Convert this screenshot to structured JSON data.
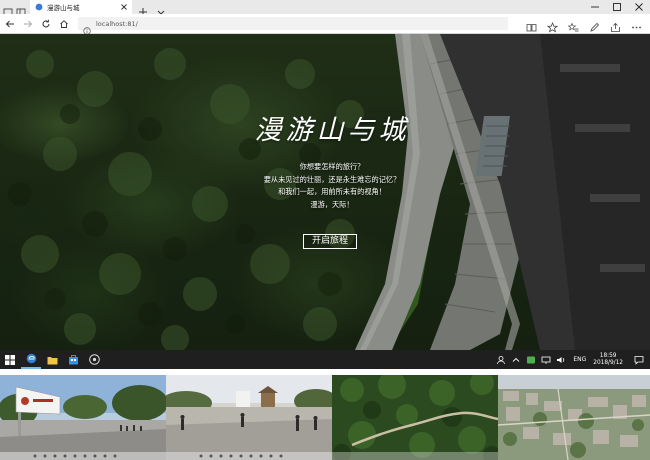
{
  "browser": {
    "tab_title": "漫游山与城",
    "url": "localhost:81/"
  },
  "hero": {
    "title": "漫游山与城",
    "lines": [
      "你想要怎样的旅行？",
      "要从未见过的壮丽，还是永生难忘的记忆？",
      "和我们一起，用前所未有的视角！",
      "漫游，天际！"
    ],
    "button_label": "开启旅程"
  },
  "taskbar": {
    "apps": [
      "windows-start",
      "edge",
      "file-explorer",
      "store",
      "media"
    ],
    "lang": "ENG",
    "time": "18:59",
    "date": "2018/9/12"
  },
  "thumbnails": [
    {
      "name": "campus-gate"
    },
    {
      "name": "plaza-pano"
    },
    {
      "name": "forest-path"
    },
    {
      "name": "city-aerial"
    }
  ],
  "colors": {
    "accent": "#3a7bd5",
    "forest": "#2b4220",
    "building": "#3c3d3c"
  }
}
